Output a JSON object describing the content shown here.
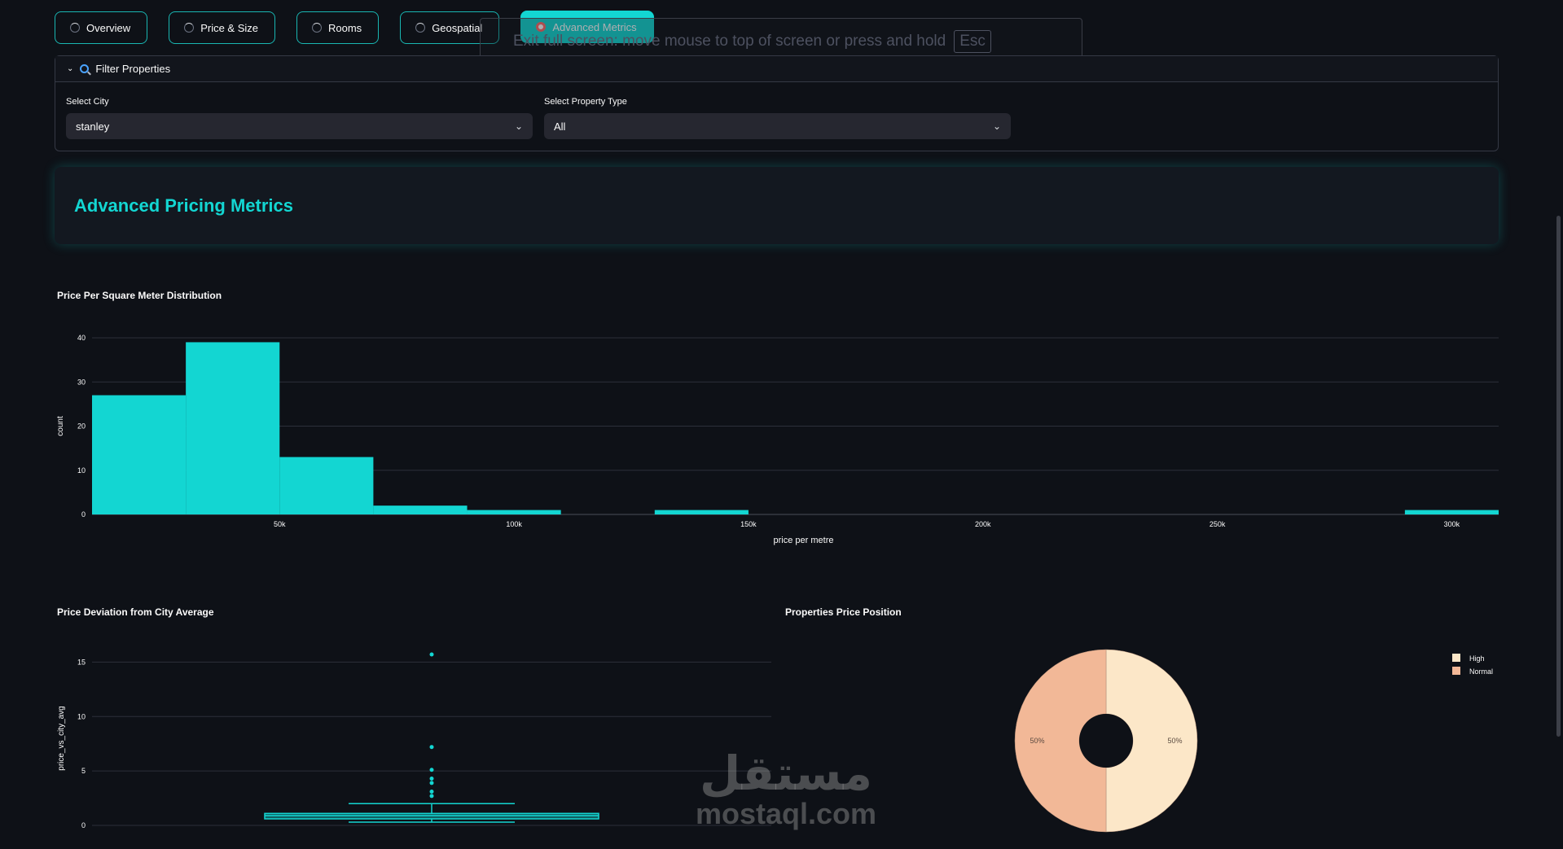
{
  "tabs": [
    {
      "label": "Overview"
    },
    {
      "label": "Price & Size"
    },
    {
      "label": "Rooms"
    },
    {
      "label": "Geospatial"
    },
    {
      "label": "Advanced Metrics"
    }
  ],
  "banner": {
    "text": "Exit full screen: move mouse to top of screen or press and hold",
    "key": "Esc"
  },
  "filter": {
    "title": "Filter Properties",
    "city_label": "Select City",
    "city_value": "stanley",
    "type_label": "Select Property Type",
    "type_value": "All"
  },
  "section": {
    "title": "Advanced Pricing Metrics"
  },
  "colors": {
    "accent": "#13d6d2",
    "high": "#fce7c8",
    "normal": "#f2b897"
  },
  "chart_data": [
    {
      "type": "bar",
      "title": "Price Per Square Meter Distribution",
      "xlabel": "price per metre",
      "ylabel": "count",
      "bin_edges": [
        10000,
        30000,
        50000,
        70000,
        90000,
        110000,
        130000,
        150000,
        170000,
        190000,
        210000,
        230000,
        250000,
        270000,
        290000,
        310000
      ],
      "values": [
        27,
        39,
        13,
        2,
        1,
        0,
        1,
        0,
        0,
        0,
        0,
        0,
        0,
        0,
        1
      ],
      "xlim": [
        10000,
        310000
      ],
      "ylim": [
        0,
        40
      ],
      "xticks": [
        {
          "v": 50000,
          "label": "50k"
        },
        {
          "v": 100000,
          "label": "100k"
        },
        {
          "v": 150000,
          "label": "150k"
        },
        {
          "v": 200000,
          "label": "200k"
        },
        {
          "v": 250000,
          "label": "250k"
        },
        {
          "v": 300000,
          "label": "300k"
        }
      ],
      "yticks": [
        0,
        10,
        20,
        30,
        40
      ]
    },
    {
      "type": "box",
      "title": "Price Deviation from City Average",
      "ylabel": "price_vs_city_avg",
      "ylim": [
        0,
        16
      ],
      "yticks": [
        0,
        5,
        10,
        15
      ],
      "box": {
        "min": 0.3,
        "q1": 0.6,
        "median": 0.9,
        "q3": 1.1,
        "max": 2.0
      },
      "outliers": [
        2.7,
        3.1,
        3.9,
        4.3,
        5.1,
        7.2,
        15.7
      ]
    },
    {
      "type": "pie",
      "title": "Properties Price Position",
      "slices": [
        {
          "label": "High",
          "value": 50,
          "text": "50%"
        },
        {
          "label": "Normal",
          "value": 50,
          "text": "50%"
        }
      ],
      "legend": "top-right"
    }
  ]
}
